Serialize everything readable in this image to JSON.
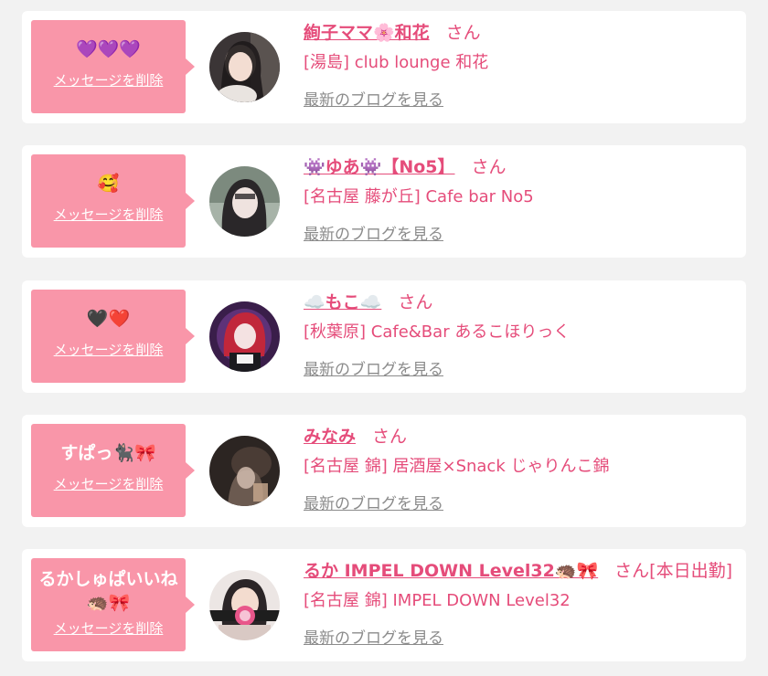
{
  "colors": {
    "page_background": "#f2f2f2",
    "card_background": "#ffffff",
    "bubble_pink": "#f996a9",
    "name_pink": "#e54c7a",
    "link_gray": "#8b8b8b"
  },
  "entries": [
    {
      "message": "💜💜💜",
      "delete_label": "メッセージを削除",
      "name": "絢子ママ🌸和花",
      "honorific": "さん",
      "status": "",
      "shop": "[湯島] club lounge 和花",
      "blog_label": "最新のブログを見る",
      "avatar_icon": "profile-photo"
    },
    {
      "message": "🥰",
      "delete_label": "メッセージを削除",
      "name": "👾ゆあ👾【No5】",
      "honorific": "さん",
      "status": "",
      "shop": "[名古屋 藤が丘] Cafe bar No5",
      "blog_label": "最新のブログを見る",
      "avatar_icon": "profile-photo"
    },
    {
      "message": "🖤❤️",
      "delete_label": "メッセージを削除",
      "name": "☁️もこ☁️",
      "honorific": "さん",
      "status": "",
      "shop": "[秋葉原] Cafe&Bar あるこほりっく",
      "blog_label": "最新のブログを見る",
      "avatar_icon": "profile-photo"
    },
    {
      "message": "すぱっ🐈‍⬛🎀",
      "delete_label": "メッセージを削除",
      "name": "みなみ",
      "honorific": "さん",
      "status": "",
      "shop": "[名古屋 錦] 居酒屋×Snack じゃりんこ錦",
      "blog_label": "最新のブログを見る",
      "avatar_icon": "profile-photo"
    },
    {
      "message": "るかしゅぱいいね🦔🎀",
      "delete_label": "メッセージを削除",
      "name": "るか IMPEL DOWN Level32🦔🎀",
      "honorific": "さん",
      "status": "[本日出勤]",
      "shop": "[名古屋 錦] IMPEL DOWN Level32",
      "blog_label": "最新のブログを見る",
      "avatar_icon": "profile-photo"
    }
  ]
}
